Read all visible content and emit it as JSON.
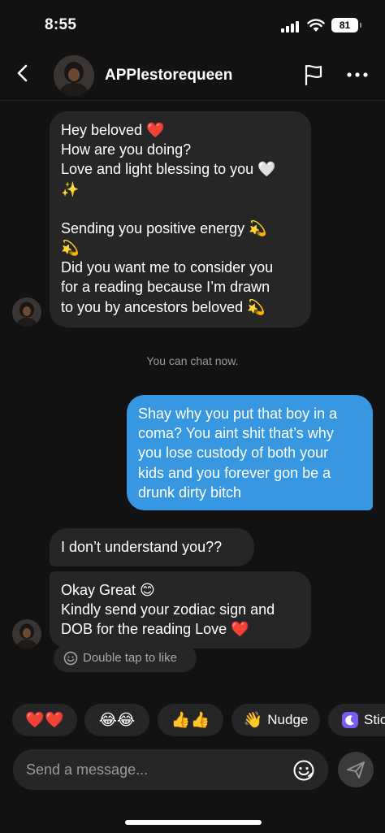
{
  "status_bar": {
    "time": "8:55",
    "battery": "81"
  },
  "header": {
    "username": "APPlestorequeen"
  },
  "messages": {
    "first": {
      "lines": [
        "Hey beloved ❤️",
        "How are you doing?",
        "Love and light blessing to you 🤍",
        "✨",
        "",
        "Sending you positive energy 💫",
        "💫",
        "Did you want me to consider you",
        "for a reading because I’m drawn",
        "to you by ancestors beloved 💫"
      ]
    },
    "system_note": "You can chat now.",
    "outgoing": {
      "lines": [
        "Shay why you put that boy in a",
        "coma? You aint shit that’s why",
        "you lose custody of both your",
        "kids and you forever gon be a",
        "drunk dirty bitch"
      ]
    },
    "second": {
      "text": "I don’t understand you??"
    },
    "third": {
      "lines": [
        "Okay Great 😊",
        "Kindly send your zodiac sign and",
        "DOB for the reading Love ❤️"
      ]
    },
    "like_hint": "Double tap to like"
  },
  "quick_replies": [
    {
      "emoji": "❤️❤️",
      "text": ""
    },
    {
      "emoji": "😂😂",
      "text": ""
    },
    {
      "emoji": "👍👍",
      "text": ""
    },
    {
      "emoji": "👋",
      "text": "Nudge"
    },
    {
      "emoji": "",
      "text": "Stic"
    }
  ],
  "composer": {
    "placeholder": "Send a message..."
  },
  "icons": {
    "back": "back-arrow-icon",
    "flag": "flag-icon",
    "more": "more-dots-icon",
    "sticker": "sticker-smile-icon",
    "send": "send-icon"
  },
  "colors": {
    "background": "#121212",
    "incoming_bubble": "#262626",
    "outgoing_bubble": "#3797e0"
  }
}
